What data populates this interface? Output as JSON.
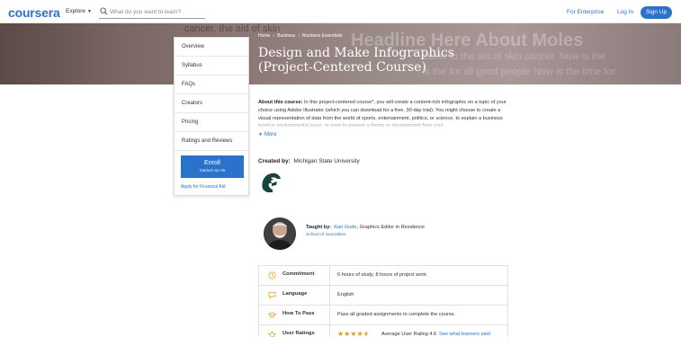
{
  "header": {
    "logo_text": "coursera",
    "explore_label": "Explore",
    "search_placeholder": "What do you want to learn?",
    "enterprise_label": "For Enterprise",
    "login_label": "Log In",
    "signup_label": "Sign Up"
  },
  "hero": {
    "breadcrumb": [
      "Home",
      "Business",
      "Business Essentials"
    ],
    "title": "Design and Make Infographics (Project-Centered Course)",
    "bg_text_headline": "Headline Here About Moles",
    "bg_text_top": "cancer.  the aid of skin",
    "bg_text_line1": "come to the aid of skin cancer. Now is the",
    "bg_text_line2": "is the for all good people Now is the time for"
  },
  "sidebar": {
    "items": [
      {
        "label": "Overview"
      },
      {
        "label": "Syllabus"
      },
      {
        "label": "FAQs"
      },
      {
        "label": "Creators"
      },
      {
        "label": "Pricing"
      },
      {
        "label": "Ratings and Reviews"
      }
    ],
    "enroll_label": "Enroll",
    "enroll_sub": "Started Apr 06",
    "financial_aid": "Apply for Financial Aid"
  },
  "about": {
    "heading": "About this course:",
    "text": " In this project-centered course*, you will create a content-rich infographic on a topic of your choice using Adobe Illustrator (which you can download for a free, 30-day trial). You might choose to create a visual representation of data from the world of sports, entertainment, politics, or science, to explain a business trend or environmental issue, or even to present a theme or development from your",
    "more_label": "More"
  },
  "created_by": {
    "label": "Created by:",
    "org": "Michigan State University"
  },
  "instructor": {
    "label": "Taught by:",
    "name": "Karl Gude",
    "role": ", Graphics Editor in Residence",
    "school": "School of Journalism"
  },
  "info_table": {
    "commitment_label": "Commitment",
    "commitment_value": "6 hours of study, 8 hours of project work",
    "language_label": "Language",
    "language_value": "English",
    "howtopass_label": "How To Pass",
    "howtopass_value": "Pass all graded assignments to complete the course.",
    "ratings_label": "User Ratings",
    "rating_value": 4.6,
    "rating_text": "Average User Rating 4.6",
    "rating_link": "See what learners said"
  },
  "colors": {
    "brand_blue": "#2a73cc",
    "msu_green": "#18453b",
    "star_orange": "#e09b1b"
  }
}
